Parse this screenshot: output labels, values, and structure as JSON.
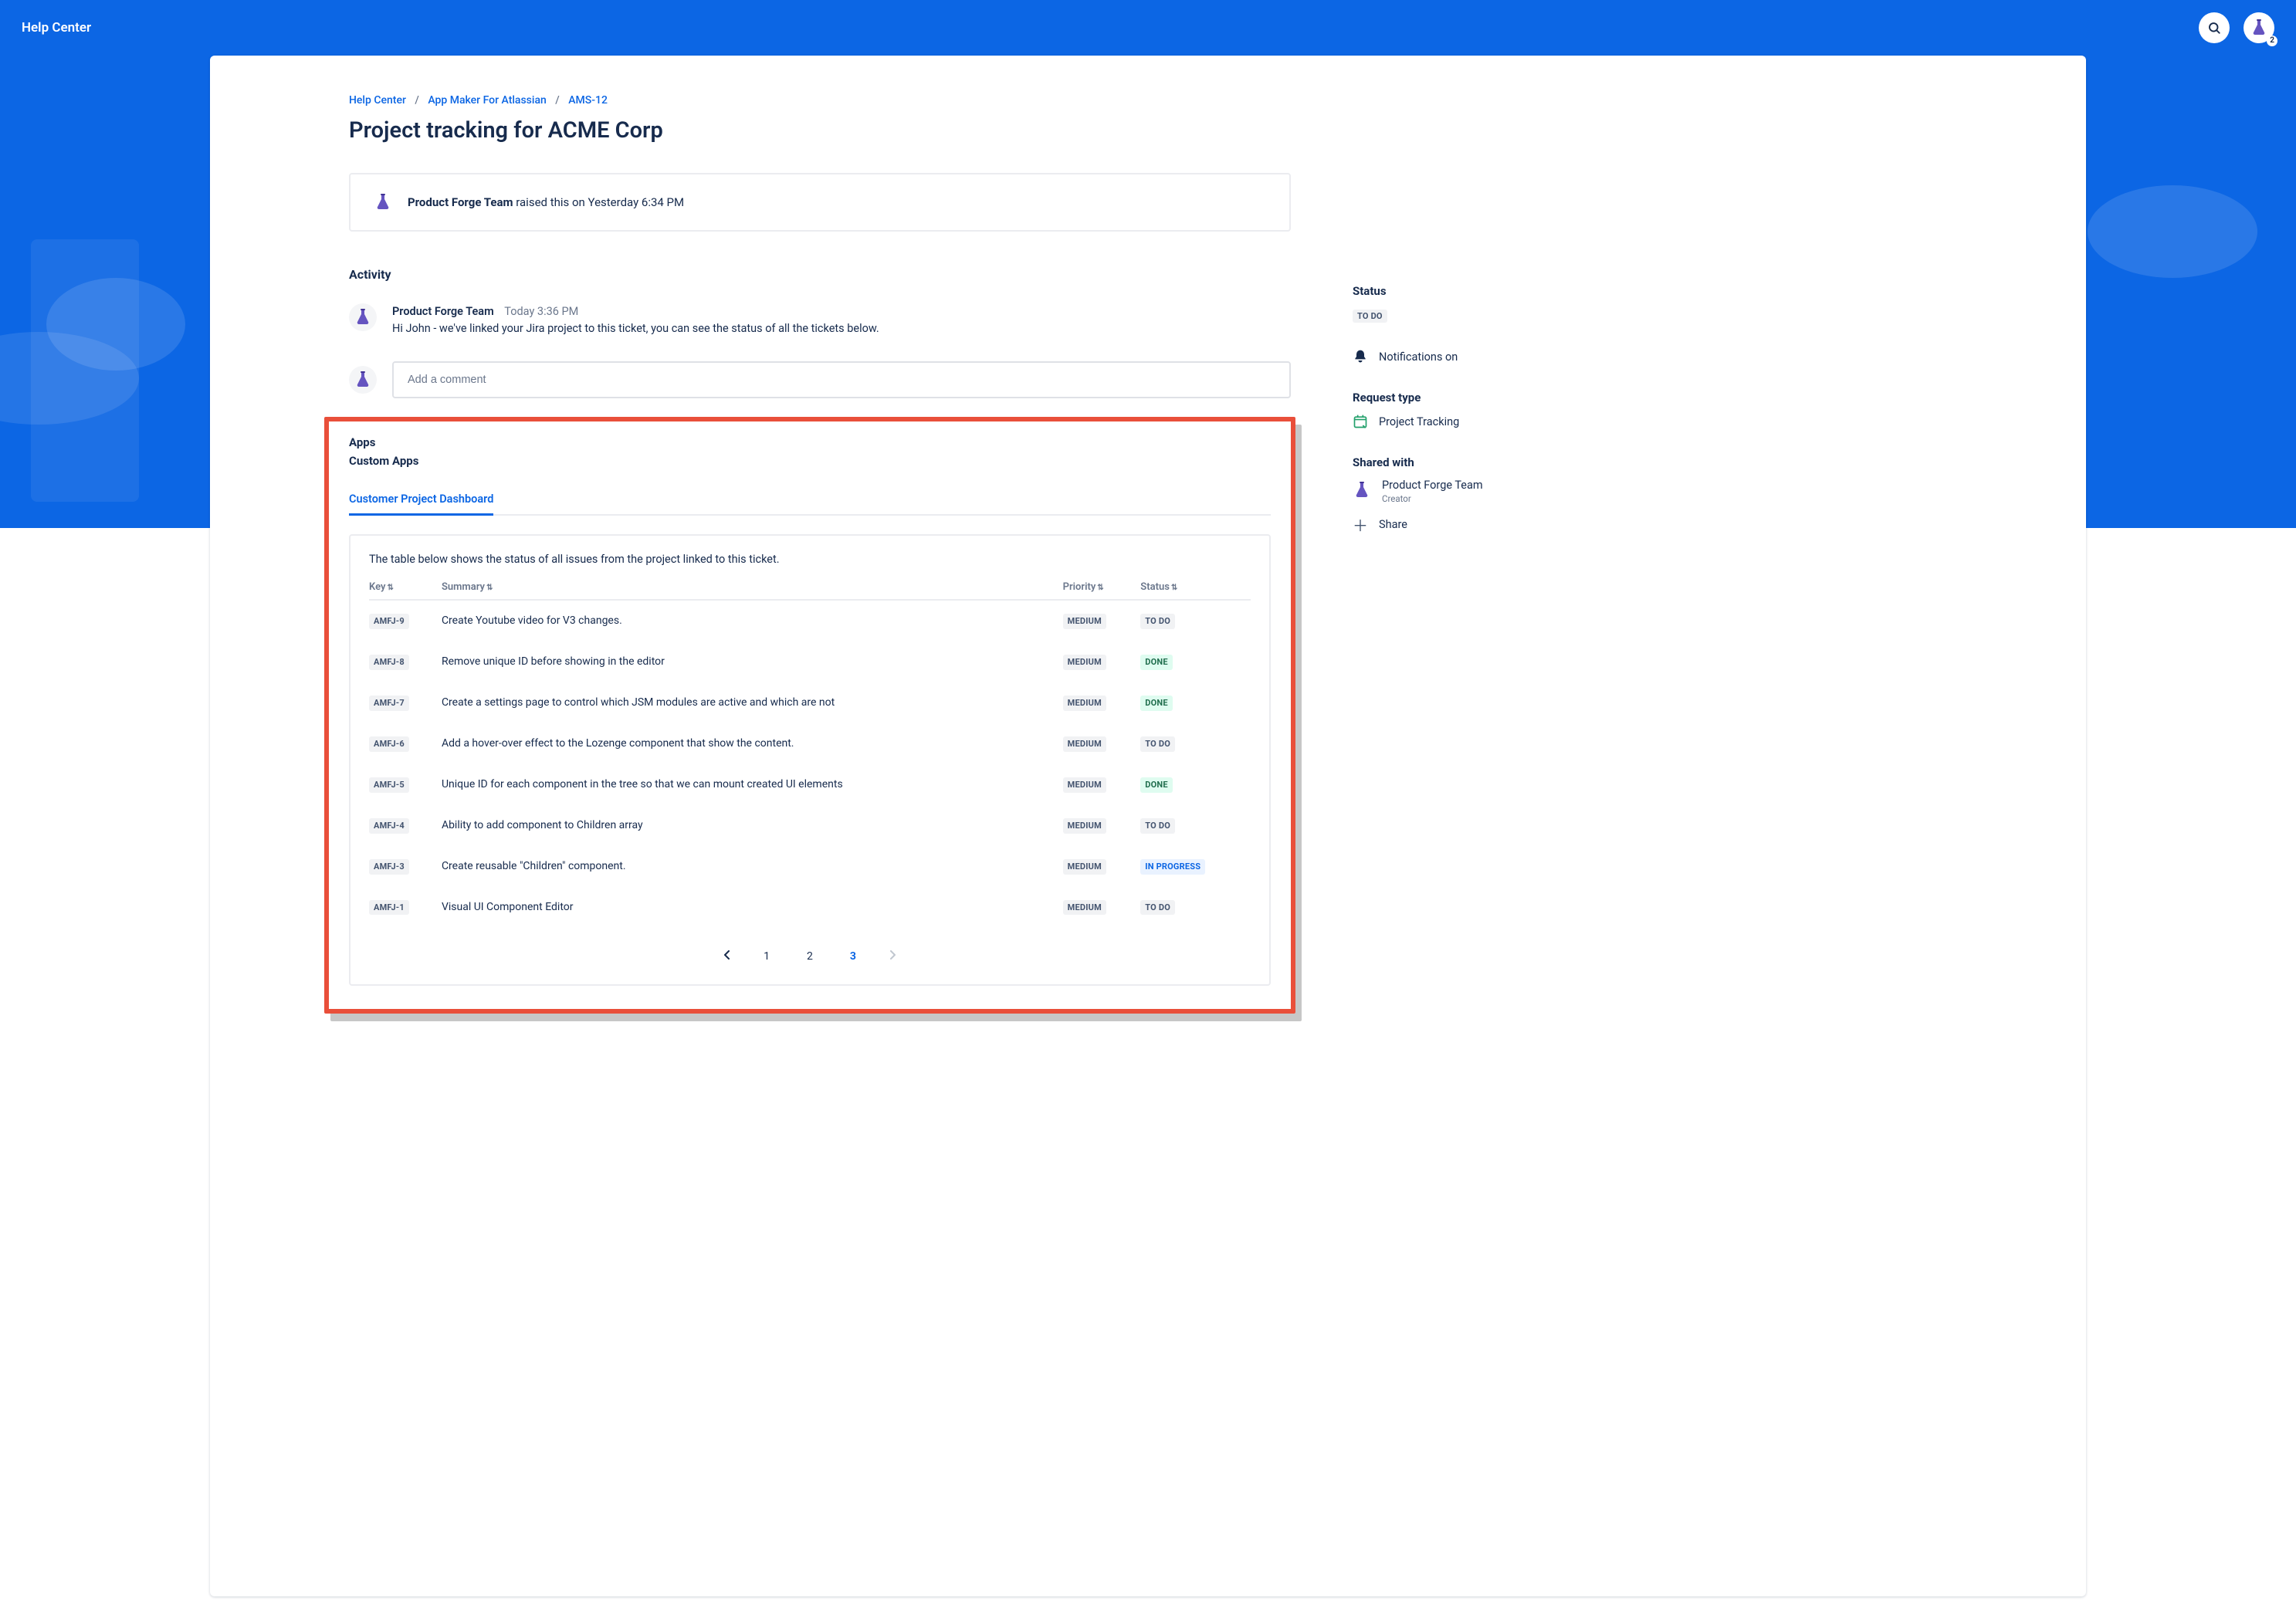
{
  "topbar": {
    "title": "Help Center",
    "avatar_badge": "2"
  },
  "breadcrumb": {
    "items": [
      "Help Center",
      "App Maker For Atlassian",
      "AMS-12"
    ]
  },
  "page": {
    "title": "Project tracking for ACME Corp"
  },
  "raised": {
    "name": "Product Forge Team",
    "suffix": " raised this on Yesterday 6:34 PM"
  },
  "activity": {
    "heading": "Activity",
    "items": [
      {
        "name": "Product Forge Team",
        "time": "Today 3:36 PM",
        "body": "Hi John - we've linked your Jira project to this ticket, you can see the status of all the tickets below."
      }
    ],
    "comment_placeholder": "Add a comment"
  },
  "apps": {
    "heading": "Apps",
    "subheading": "Custom Apps",
    "tab_label": "Customer Project Dashboard",
    "panel_intro": "The table below shows the status of all issues from the project linked to this ticket.",
    "columns": {
      "key": "Key",
      "summary": "Summary",
      "priority": "Priority",
      "status": "Status"
    },
    "rows": [
      {
        "key": "AMFJ-9",
        "summary": "Create Youtube video for V3 changes.",
        "priority": "MEDIUM",
        "status": "TO DO",
        "status_kind": "grey"
      },
      {
        "key": "AMFJ-8",
        "summary": "Remove unique ID before showing in the editor",
        "priority": "MEDIUM",
        "status": "DONE",
        "status_kind": "green"
      },
      {
        "key": "AMFJ-7",
        "summary": "Create a settings page to control which JSM modules are active and which are not",
        "priority": "MEDIUM",
        "status": "DONE",
        "status_kind": "green"
      },
      {
        "key": "AMFJ-6",
        "summary": "Add a hover-over effect to the Lozenge component that show the content.",
        "priority": "MEDIUM",
        "status": "TO DO",
        "status_kind": "grey"
      },
      {
        "key": "AMFJ-5",
        "summary": "Unique ID for each component in the tree so that we can mount created UI elements",
        "priority": "MEDIUM",
        "status": "DONE",
        "status_kind": "green"
      },
      {
        "key": "AMFJ-4",
        "summary": "Ability to add component to Children array",
        "priority": "MEDIUM",
        "status": "TO DO",
        "status_kind": "grey"
      },
      {
        "key": "AMFJ-3",
        "summary": "Create reusable \"Children\" component.",
        "priority": "MEDIUM",
        "status": "IN PROGRESS",
        "status_kind": "blue"
      },
      {
        "key": "AMFJ-1",
        "summary": "Visual UI Component Editor",
        "priority": "MEDIUM",
        "status": "TO DO",
        "status_kind": "grey"
      }
    ],
    "pager": {
      "pages": [
        "1",
        "2",
        "3"
      ],
      "active_index": 2
    }
  },
  "sidebar": {
    "status": {
      "heading": "Status",
      "value": "TO DO"
    },
    "notifications": "Notifications on",
    "request_type": {
      "heading": "Request type",
      "value": "Project Tracking"
    },
    "shared": {
      "heading": "Shared with",
      "name": "Product Forge Team",
      "role": "Creator",
      "share_label": "Share"
    }
  }
}
